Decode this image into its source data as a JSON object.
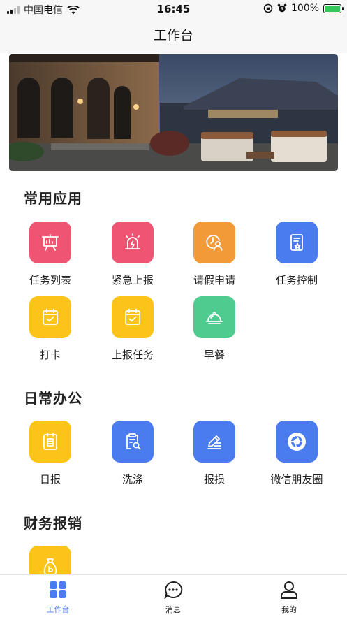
{
  "status_bar": {
    "carrier": "中国电信",
    "time": "16:45",
    "battery": "100%"
  },
  "header": {
    "title": "工作台"
  },
  "sections": [
    {
      "title": "常用应用",
      "items": [
        {
          "label": "任务列表",
          "icon": "presentation-chart-icon",
          "color": "#ef5572"
        },
        {
          "label": "紧急上报",
          "icon": "alarm-siren-icon",
          "color": "#ef5572"
        },
        {
          "label": "请假申请",
          "icon": "clock-person-icon",
          "color": "#f39a38"
        },
        {
          "label": "任务控制",
          "icon": "document-star-icon",
          "color": "#4a7cf0"
        },
        {
          "label": "打卡",
          "icon": "calendar-check-icon",
          "color": "#fcc419"
        },
        {
          "label": "上报任务",
          "icon": "calendar-check-icon",
          "color": "#fcc419"
        },
        {
          "label": "早餐",
          "icon": "food-cloche-icon",
          "color": "#4fcb8f"
        }
      ]
    },
    {
      "title": "日常办公",
      "items": [
        {
          "label": "日报",
          "icon": "daily-report-icon",
          "color": "#fcc419"
        },
        {
          "label": "洗涤",
          "icon": "clipboard-search-icon",
          "color": "#4a7cf0"
        },
        {
          "label": "报损",
          "icon": "pen-lines-icon",
          "color": "#4a7cf0"
        },
        {
          "label": "微信朋友圈",
          "icon": "camera-aperture-icon",
          "color": "#4a7cf0"
        }
      ]
    },
    {
      "title": "财务报销",
      "items": [
        {
          "label": "",
          "icon": "money-bag-icon",
          "color": "#fcc419"
        }
      ]
    }
  ],
  "tab_bar": {
    "tabs": [
      {
        "label": "工作台",
        "icon": "grid-icon",
        "active": true
      },
      {
        "label": "消息",
        "icon": "chat-bubble-icon",
        "active": false
      },
      {
        "label": "我的",
        "icon": "person-icon",
        "active": false
      }
    ],
    "active_color": "#4a7cf0"
  }
}
